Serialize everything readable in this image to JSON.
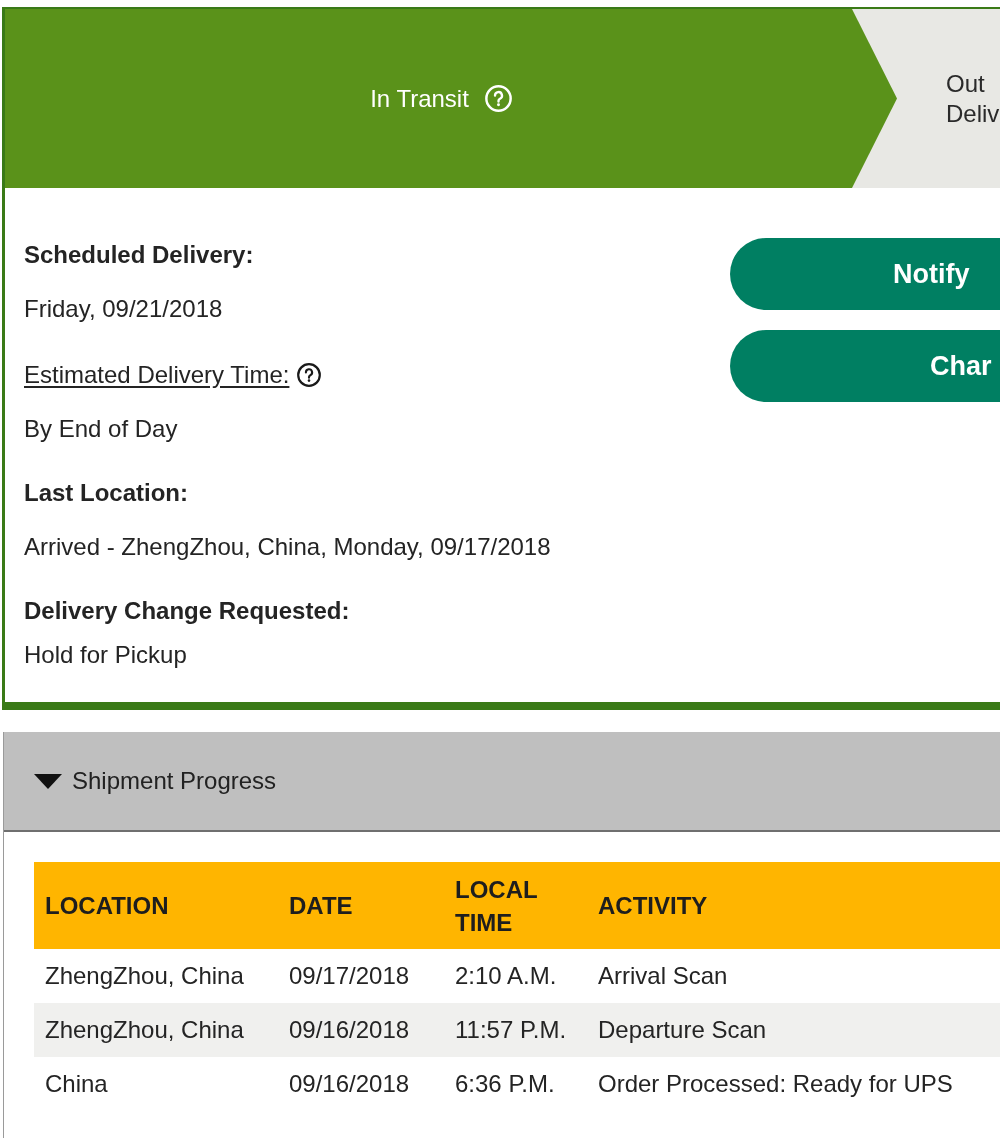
{
  "steps": [
    {
      "lines": [
        "In Transit"
      ],
      "selected": true,
      "help": true
    },
    {
      "lines": [
        "Out",
        "Deliv"
      ],
      "selected": false
    }
  ],
  "details": [
    {
      "kind": "heading",
      "text": "Scheduled Delivery:"
    },
    {
      "kind": "value",
      "text": "Friday, 09/21/2018"
    },
    {
      "kind": "link",
      "text": "Estimated Delivery Time:",
      "help": true
    },
    {
      "kind": "value",
      "text": "By End of Day"
    },
    {
      "kind": "heading",
      "text": "Last Location:"
    },
    {
      "kind": "value",
      "text": "Arrived - ZhengZhou, China, Monday, 09/17/2018"
    },
    {
      "kind": "heading",
      "text": "Delivery Change Requested:"
    },
    {
      "kind": "value",
      "text": "Hold for Pickup"
    }
  ],
  "buttons": [
    "Notify",
    "Char"
  ],
  "progress": {
    "title": "Shipment Progress",
    "expanded": true,
    "columns": [
      "LOCATION",
      "DATE",
      "LOCAL TIME",
      "ACTIVITY"
    ],
    "rows": [
      [
        "ZhengZhou, China",
        "09/17/2018",
        "2:10 A.M.",
        "Arrival Scan"
      ],
      [
        "ZhengZhou, China",
        "09/16/2018",
        "11:57 P.M.",
        "Departure Scan"
      ],
      [
        "China",
        "09/16/2018",
        "6:36 P.M.",
        "Order Processed: Ready for UPS"
      ]
    ]
  }
}
